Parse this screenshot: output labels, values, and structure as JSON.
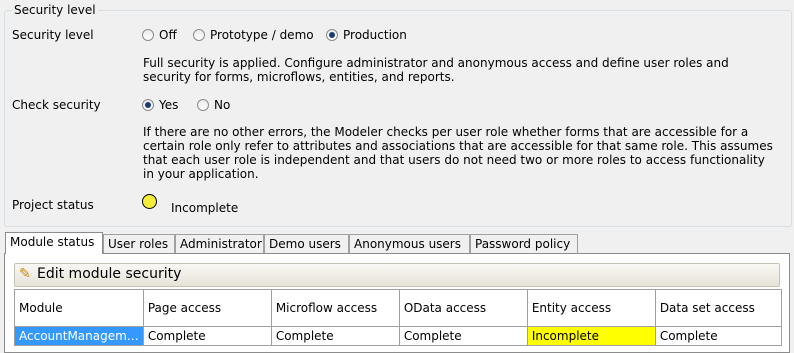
{
  "group": {
    "title": "Security level"
  },
  "security_level": {
    "label": "Security level",
    "options": [
      {
        "label": "Off",
        "checked": false
      },
      {
        "label": "Prototype / demo",
        "checked": false
      },
      {
        "label": "Production",
        "checked": true
      }
    ],
    "description": "Full security is applied. Configure administrator and anonymous access and define user roles and security for forms, microflows, entities, and reports."
  },
  "check_security": {
    "label": "Check security",
    "options": [
      {
        "label": "Yes",
        "checked": true
      },
      {
        "label": "No",
        "checked": false
      }
    ],
    "description": "If there are no other errors, the Modeler checks per user role whether forms that are accessible for a certain role only refer to attributes and associations that are accessible for that same role. This assumes that each user role is independent and that users do not need two or more roles to access functionality in your application."
  },
  "project_status": {
    "label": "Project status",
    "status_text": "Incomplete",
    "indicator_color": "#f5ec3b"
  },
  "tabs": [
    {
      "label": "Module status",
      "active": true
    },
    {
      "label": "User roles",
      "active": false
    },
    {
      "label": "Administrator",
      "active": false
    },
    {
      "label": "Demo users",
      "active": false
    },
    {
      "label": "Anonymous users",
      "active": false
    },
    {
      "label": "Password policy",
      "active": false
    }
  ],
  "toolbar": {
    "edit_label": "Edit module security",
    "icon": "pencil-icon"
  },
  "table": {
    "columns": [
      "Module",
      "Page access",
      "Microflow access",
      "OData access",
      "Entity access",
      "Data set access"
    ],
    "rows": [
      [
        "AccountManagem…",
        "Complete",
        "Complete",
        "Complete",
        "Incomplete",
        "Complete"
      ]
    ]
  },
  "colors": {
    "selection": "#3399ff",
    "warning": "#ffff00"
  }
}
